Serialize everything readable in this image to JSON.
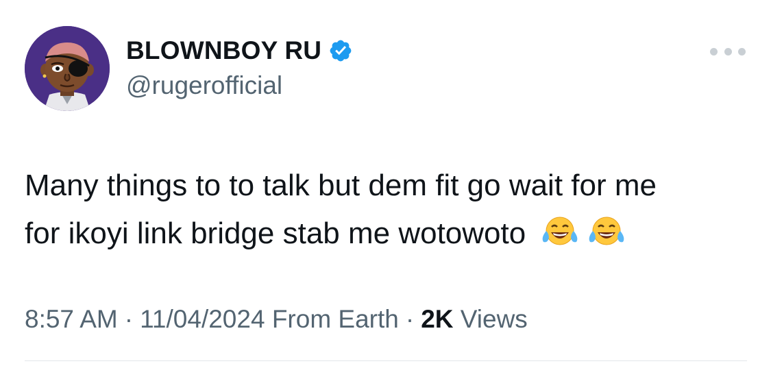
{
  "author": {
    "display_name": "BLOWNBOY RU",
    "handle": "@rugerofficial",
    "avatar_icon": "avatar-cartoon-eyepatch",
    "verified_icon": "verified-badge-icon",
    "verified_color": "#1d9bf0"
  },
  "tweet": {
    "line1": "Many things to to talk but dem fit go wait for me",
    "line2": "for ikoyi link bridge stab me wotowoto",
    "emojis": [
      "😂",
      "😂"
    ]
  },
  "meta": {
    "time": "8:57 AM",
    "date": "11/04/2024",
    "source": "From Earth",
    "separator": "·",
    "views_count": "2K",
    "views_label": "Views"
  },
  "colors": {
    "text_primary": "#0f1419",
    "text_secondary": "#536471",
    "avatar_bg": "#4a2f86"
  }
}
